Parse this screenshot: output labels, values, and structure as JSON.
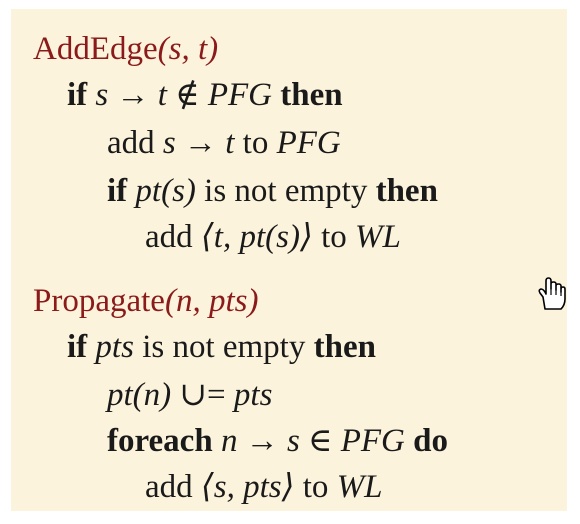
{
  "addedge": {
    "name": "AddEdge",
    "params": "(s, t)",
    "l1_kw": "if",
    "l1_cond": "s → t ∉ PFG",
    "l1_then": "then",
    "l2_add": "add",
    "l2_edge": "s → t",
    "l2_to": "to",
    "l2_pfg": "PFG",
    "l3_kw": "if",
    "l3_expr": "pt(s)",
    "l3_rest": "is not empty",
    "l3_then": "then",
    "l4_add": "add",
    "l4_pair": "⟨t, pt(s)⟩",
    "l4_to": "to",
    "l4_wl": "WL"
  },
  "propagate": {
    "name": "Propagate",
    "params": "(n, pts)",
    "l1_kw": "if",
    "l1_var": "pts",
    "l1_rest": "is not empty",
    "l1_then": "then",
    "l2_expr": "pt(n)",
    "l2_op": "∪=",
    "l2_var": "pts",
    "l3_kw": "foreach",
    "l3_cond": "n → s ∈ PFG",
    "l3_do": "do",
    "l4_add": "add",
    "l4_pair": "⟨s, pts⟩",
    "l4_to": "to",
    "l4_wl": "WL"
  }
}
